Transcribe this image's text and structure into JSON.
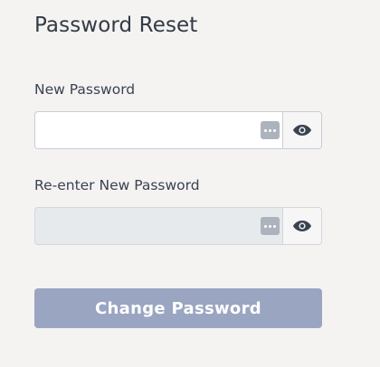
{
  "form": {
    "title": "Password Reset",
    "new_password": {
      "label": "New Password",
      "value": "",
      "placeholder": ""
    },
    "confirm_password": {
      "label": "Re-enter New Password",
      "value": "",
      "placeholder": "",
      "disabled": true
    },
    "submit_label": "Change Password",
    "submit_disabled": true
  },
  "icons": {
    "password_manager": "password-manager-key-icon",
    "toggle_visibility": "eye-icon"
  },
  "colors": {
    "background": "#f4f3f2",
    "button_disabled": "#9aa5c2",
    "input_disabled": "#e7eaed",
    "text": "#333a45"
  }
}
